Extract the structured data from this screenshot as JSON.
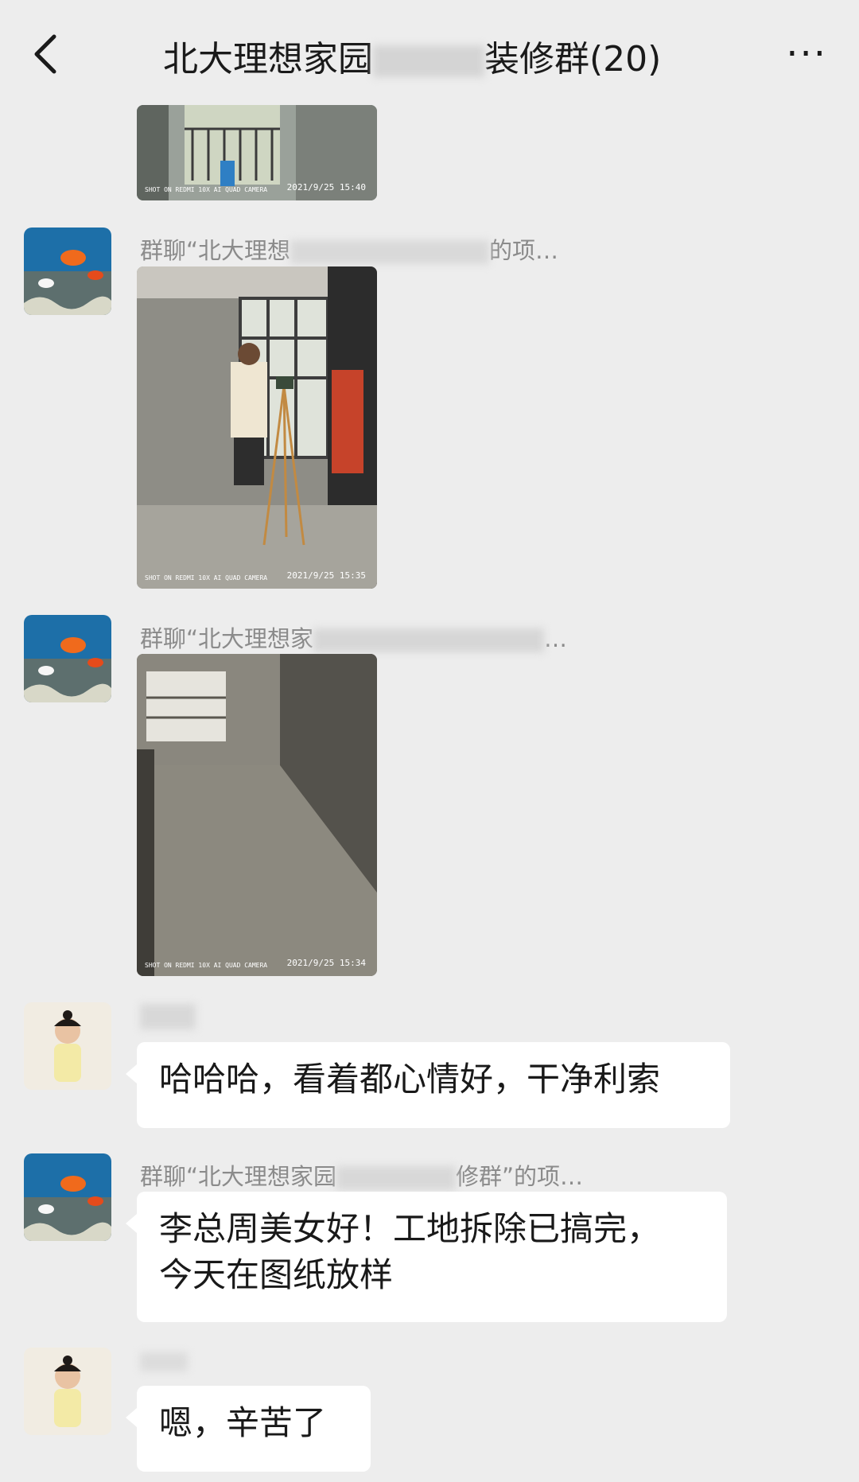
{
  "header": {
    "title": "北大理想家园",
    "title_suffix": "装修群(20)",
    "more_label": "···"
  },
  "messages": [
    {
      "type": "image",
      "sender": "",
      "image_text": {
        "camera": "SHOT ON REDMI 10X AI QUAD CAMERA",
        "timestamp": "2021/9/25 15:40"
      }
    },
    {
      "type": "image",
      "sender": "群聊“北大理想",
      "sender_tail": "的项…",
      "avatar": "aquarium-avatar",
      "image_text": {
        "camera": "SHOT ON REDMI 10X AI QUAD CAMERA",
        "timestamp": "2021/9/25 15:35"
      }
    },
    {
      "type": "image",
      "sender": "群聊“北大理想家",
      "sender_tail": "…",
      "avatar": "aquarium-avatar",
      "image_text": {
        "camera": "SHOT ON REDMI 10X AI QUAD CAMERA",
        "timestamp": "2021/9/25 15:34"
      }
    },
    {
      "type": "text",
      "sender": "",
      "avatar": "child-avatar",
      "text": "哈哈哈，看着都心情好，干净利索"
    },
    {
      "type": "text",
      "sender": "群聊“北大理想家园",
      "sender_tail": "修群”的项…",
      "avatar": "aquarium-avatar",
      "text_line1": "李总周美女好！工地拆除已搞完，",
      "text_line2": "今天在图纸放样"
    },
    {
      "type": "text",
      "sender": "",
      "avatar": "child-avatar",
      "text": "嗯，辛苦了"
    }
  ]
}
